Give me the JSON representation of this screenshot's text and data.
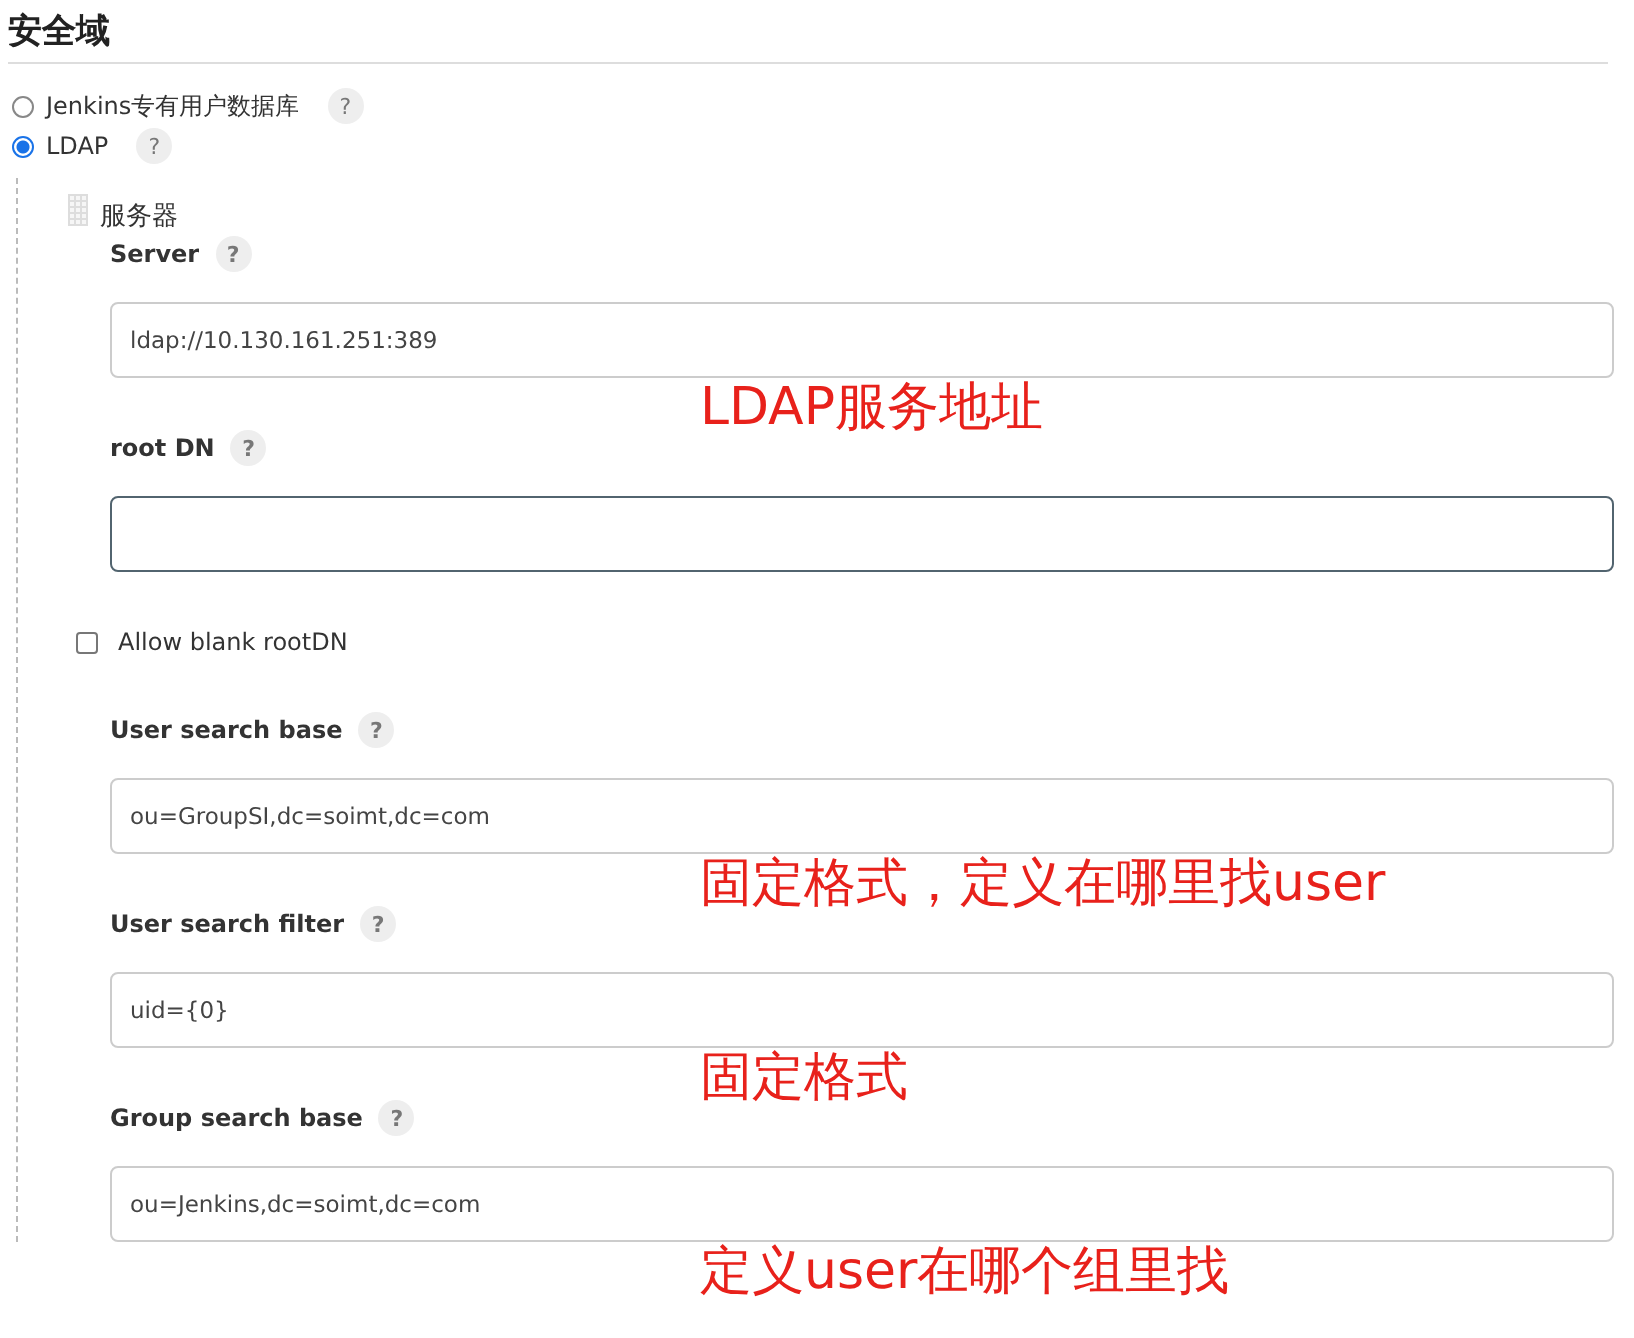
{
  "section": {
    "title": "安全域"
  },
  "realms": [
    {
      "label": "Jenkins专有用户数据库",
      "selected": false,
      "help": "?"
    },
    {
      "label": "LDAP",
      "selected": true,
      "help": "?"
    }
  ],
  "server_group": {
    "title": "服务器"
  },
  "fields": [
    {
      "kind": "text",
      "label": "Server",
      "help": "?",
      "value": "ldap://10.130.161.251:389",
      "focused": false,
      "annotation": "LDAP服务地址"
    },
    {
      "kind": "text",
      "label": "root DN",
      "help": "?",
      "focused": true
    },
    {
      "kind": "checkbox",
      "label": "Allow blank rootDN",
      "checked": false
    },
    {
      "kind": "text",
      "label": "User search base",
      "help": "?",
      "value": "ou=GroupSI,dc=soimt,dc=com",
      "focused": false,
      "annotation": "固定格式，定义在哪里找user"
    },
    {
      "kind": "text",
      "label": "User search filter",
      "help": "?",
      "value": "uid={0}",
      "focused": false,
      "annotation": "固定格式"
    },
    {
      "kind": "text",
      "label": "Group search base",
      "help": "?",
      "value": "ou=Jenkins,dc=soimt,dc=com",
      "focused": false,
      "annotation": "定义user在哪个组里找"
    }
  ]
}
